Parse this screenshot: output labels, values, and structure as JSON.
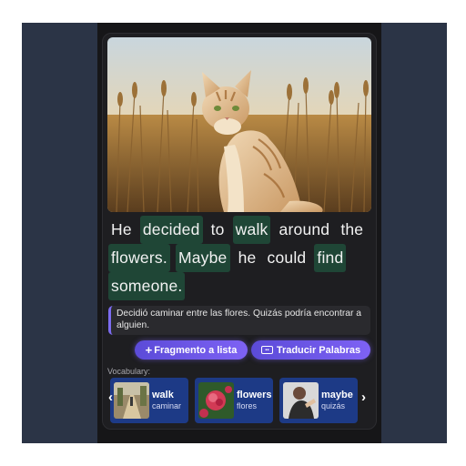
{
  "sentence": {
    "words": [
      {
        "text": "He",
        "highlighted": false
      },
      {
        "text": "decided",
        "highlighted": true
      },
      {
        "text": "to",
        "highlighted": false
      },
      {
        "text": "walk",
        "highlighted": true
      },
      {
        "text": "around",
        "highlighted": false
      },
      {
        "text": "the",
        "highlighted": false
      },
      {
        "text": "flowers.",
        "highlighted": true
      },
      {
        "text": "Maybe",
        "highlighted": true
      },
      {
        "text": "he",
        "highlighted": false
      },
      {
        "text": "could",
        "highlighted": false
      },
      {
        "text": "find",
        "highlighted": true
      },
      {
        "text": "someone.",
        "highlighted": true
      }
    ]
  },
  "translation": "Decidió caminar entre las flores. Quizás podría encontrar a alguien.",
  "buttons": {
    "fragment_label": "Fragmento a lista",
    "translate_label": "Traducir Palabras"
  },
  "vocabulary": {
    "label": "Vocabulary:",
    "items": [
      {
        "word": "walk",
        "translation": "caminar",
        "icon": "path-photo"
      },
      {
        "word": "flowers",
        "translation": "flores",
        "icon": "flower-photo"
      },
      {
        "word": "maybe",
        "translation": "quizás",
        "icon": "person-photo"
      }
    ]
  },
  "colors": {
    "highlight": "#1f4636",
    "accent": "#7c6cf0",
    "vocab_card": "#1d3a86"
  }
}
